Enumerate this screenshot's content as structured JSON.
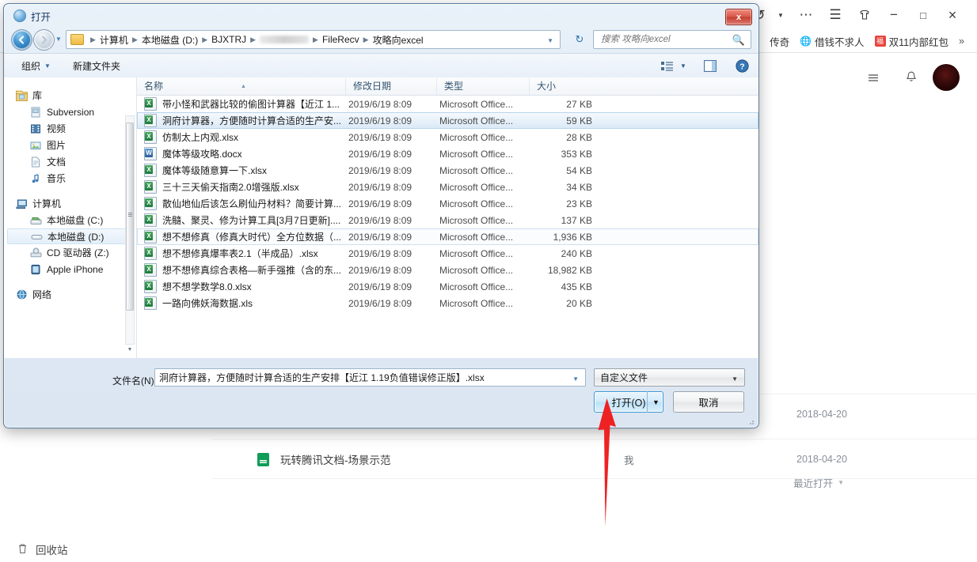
{
  "background_app": {
    "browser_icons": [
      "undo-icon",
      "more-icon",
      "menu-icon",
      "shirt-icon",
      "minimize-icon",
      "maximize-icon",
      "close-icon"
    ],
    "undo_label": "↺",
    "more_label": "⋯",
    "menu_label": "☰",
    "minimize_label": "−",
    "maximize_label": "□",
    "close_label": "×",
    "bookmarks": [
      {
        "label": "传奇",
        "icon": "none"
      },
      {
        "label": "借钱不求人",
        "icon": "globe-icon"
      },
      {
        "label": "双11内部红包",
        "icon": "red-badge-icon",
        "badge_text": "福"
      }
    ],
    "bookmarks_overflow": "»",
    "app_icons": [
      "hamburger-icon",
      "bell-icon",
      "avatar"
    ],
    "hamburger_label": "☰",
    "bell_label": "ὑ4",
    "recycle_bin_label": "回收站",
    "recent_column_header": "最近打开",
    "recent_caret": "▼",
    "rows": [
      {
        "name": "",
        "owner": "",
        "date": "2018-04-20"
      },
      {
        "name": "玩转腾讯文档-场景示范",
        "owner": "我",
        "date": "2018-04-20"
      }
    ]
  },
  "dialog": {
    "title": "打开",
    "close_label": "x",
    "nav": {
      "back_label": "⬅",
      "forward_label": "➡",
      "recent_caret": "▼",
      "refresh_label": "↻",
      "address_caret": "▼"
    },
    "breadcrumbs": [
      {
        "label": "计算机",
        "blurred": false
      },
      {
        "label": "本地磁盘 (D:)",
        "blurred": false
      },
      {
        "label": "BJXTRJ",
        "blurred": false
      },
      {
        "label": "",
        "blurred": true
      },
      {
        "label": "FileRecv",
        "blurred": false
      },
      {
        "label": "攻略向excel",
        "blurred": false
      }
    ],
    "search": {
      "placeholder": "搜索 攻略向excel",
      "value": "",
      "icon": "search-icon"
    },
    "toolbar": {
      "organize_label": "组织",
      "organize_caret": "▼",
      "new_folder_label": "新建文件夹",
      "view_caret": "▼",
      "view_icon": "list-view-icon",
      "preview_icon": "preview-pane-icon",
      "help_icon": "help-icon",
      "help_label": "?"
    },
    "nav_pane": {
      "groups": [
        {
          "label": "库",
          "icon": "library-icon",
          "items": [
            {
              "label": "Subversion",
              "icon": "subversion-icon",
              "selected": false
            },
            {
              "label": "视频",
              "icon": "video-icon",
              "selected": false
            },
            {
              "label": "图片",
              "icon": "pictures-icon",
              "selected": false
            },
            {
              "label": "文档",
              "icon": "documents-icon",
              "selected": false
            },
            {
              "label": "音乐",
              "icon": "music-icon",
              "selected": false
            }
          ]
        },
        {
          "label": "计算机",
          "icon": "computer-icon",
          "items": [
            {
              "label": "本地磁盘 (C:)",
              "icon": "system-drive-icon",
              "selected": false
            },
            {
              "label": "本地磁盘 (D:)",
              "icon": "drive-icon",
              "selected": true
            },
            {
              "label": "CD 驱动器 (Z:)",
              "icon": "cd-drive-icon",
              "selected": false
            },
            {
              "label": "Apple iPhone",
              "icon": "iphone-icon",
              "selected": false
            }
          ]
        },
        {
          "label": "网络",
          "icon": "network-icon",
          "items": []
        }
      ],
      "scroll_down_label": "▼"
    },
    "file_list": {
      "columns": [
        {
          "key": "name",
          "label": "名称",
          "sorted": true,
          "sort_arrow": "▲"
        },
        {
          "key": "date",
          "label": "修改日期",
          "sorted": false
        },
        {
          "key": "type",
          "label": "类型",
          "sorted": false
        },
        {
          "key": "size",
          "label": "大小",
          "sorted": false
        }
      ],
      "rows": [
        {
          "name": "带小怪和武器比较的偷图计算器【近江 1...",
          "date": "2019/6/19 8:09",
          "type": "Microsoft Office...",
          "size": "27 KB",
          "icon": "excel-file-icon",
          "selected": false
        },
        {
          "name": "洞府计算器，方便随时计算合适的生产安...",
          "date": "2019/6/19 8:09",
          "type": "Microsoft Office...",
          "size": "59 KB",
          "icon": "excel-file-icon",
          "selected": true
        },
        {
          "name": "仿制太上内观.xlsx",
          "date": "2019/6/19 8:09",
          "type": "Microsoft Office...",
          "size": "28 KB",
          "icon": "excel-file-icon",
          "selected": false
        },
        {
          "name": "魔体等级攻略.docx",
          "date": "2019/6/19 8:09",
          "type": "Microsoft Office...",
          "size": "353 KB",
          "icon": "word-file-icon",
          "selected": false
        },
        {
          "name": "魔体等级随意算一下.xlsx",
          "date": "2019/6/19 8:09",
          "type": "Microsoft Office...",
          "size": "54 KB",
          "icon": "excel-file-icon",
          "selected": false
        },
        {
          "name": "三十三天偷天指南2.0增强版.xlsx",
          "date": "2019/6/19 8:09",
          "type": "Microsoft Office...",
          "size": "34 KB",
          "icon": "excel-file-icon",
          "selected": false
        },
        {
          "name": "散仙地仙后该怎么刷仙丹材料？简要计算...",
          "date": "2019/6/19 8:09",
          "type": "Microsoft Office...",
          "size": "23 KB",
          "icon": "excel-file-icon",
          "selected": false
        },
        {
          "name": "洗髓、聚灵、修为计算工具[3月7日更新]....",
          "date": "2019/6/19 8:09",
          "type": "Microsoft Office...",
          "size": "137 KB",
          "icon": "excel-file-icon",
          "selected": false
        },
        {
          "name": "想不想修真（修真大时代）全方位数据（...",
          "date": "2019/6/19 8:09",
          "type": "Microsoft Office...",
          "size": "1,936 KB",
          "icon": "excel-file-icon",
          "selected": false,
          "focused": true
        },
        {
          "name": "想不想修真爆率表2.1（半成品）.xlsx",
          "date": "2019/6/19 8:09",
          "type": "Microsoft Office...",
          "size": "240 KB",
          "icon": "excel-file-icon",
          "selected": false
        },
        {
          "name": "想不想修真综合表格—新手强推（含的东...",
          "date": "2019/6/19 8:09",
          "type": "Microsoft Office...",
          "size": "18,982 KB",
          "icon": "excel-file-icon",
          "selected": false
        },
        {
          "name": "想不想学数学8.0.xlsx",
          "date": "2019/6/19 8:09",
          "type": "Microsoft Office...",
          "size": "435 KB",
          "icon": "excel-file-icon",
          "selected": false
        },
        {
          "name": "一路向佛妖海数据.xls",
          "date": "2019/6/19 8:09",
          "type": "Microsoft Office...",
          "size": "20 KB",
          "icon": "excel-file-icon",
          "selected": false
        }
      ]
    },
    "bottom": {
      "filename_label": "文件名(N):",
      "filename_value": "洞府计算器，方便随时计算合适的生产安排【近江 1.19负值错误修正版】.xlsx",
      "filename_placeholder": "",
      "filename_caret": "▼",
      "filter_value": "自定义文件",
      "filter_caret": "▼",
      "open_label": "打开(O)",
      "open_split_caret": "▼",
      "cancel_label": "取消"
    }
  },
  "annotation": {
    "arrow_color": "#ee2222",
    "points_to": "open-button"
  }
}
